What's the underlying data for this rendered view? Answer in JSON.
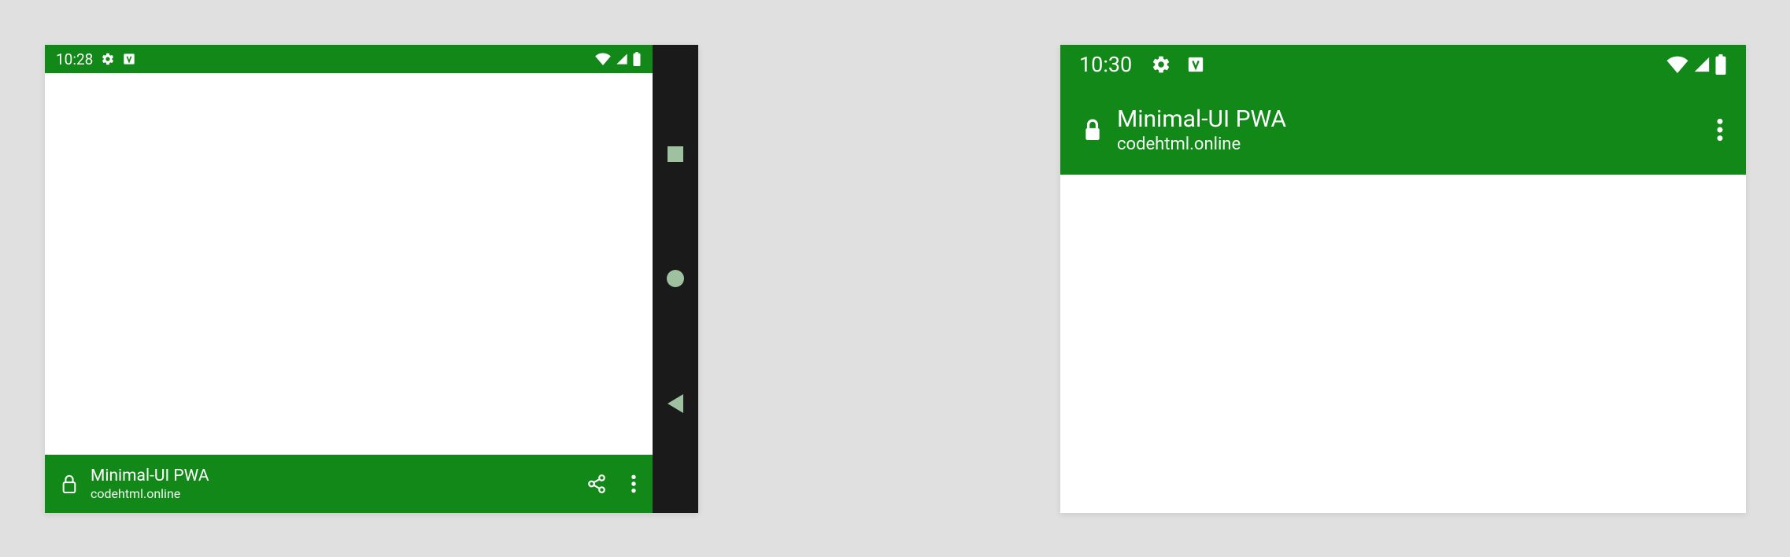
{
  "colors": {
    "brand_green": "#118817",
    "page_bg": "#e0e0e0",
    "nav_bg": "#1a1a1a",
    "nav_icon": "#9fc1a0"
  },
  "left_device": {
    "status": {
      "time": "10:28"
    },
    "app_bar": {
      "title": "Minimal-UI PWA",
      "origin": "codehtml.online"
    }
  },
  "right_device": {
    "status": {
      "time": "10:30"
    },
    "app_bar": {
      "title": "Minimal-UI PWA",
      "origin": "codehtml.online"
    }
  }
}
